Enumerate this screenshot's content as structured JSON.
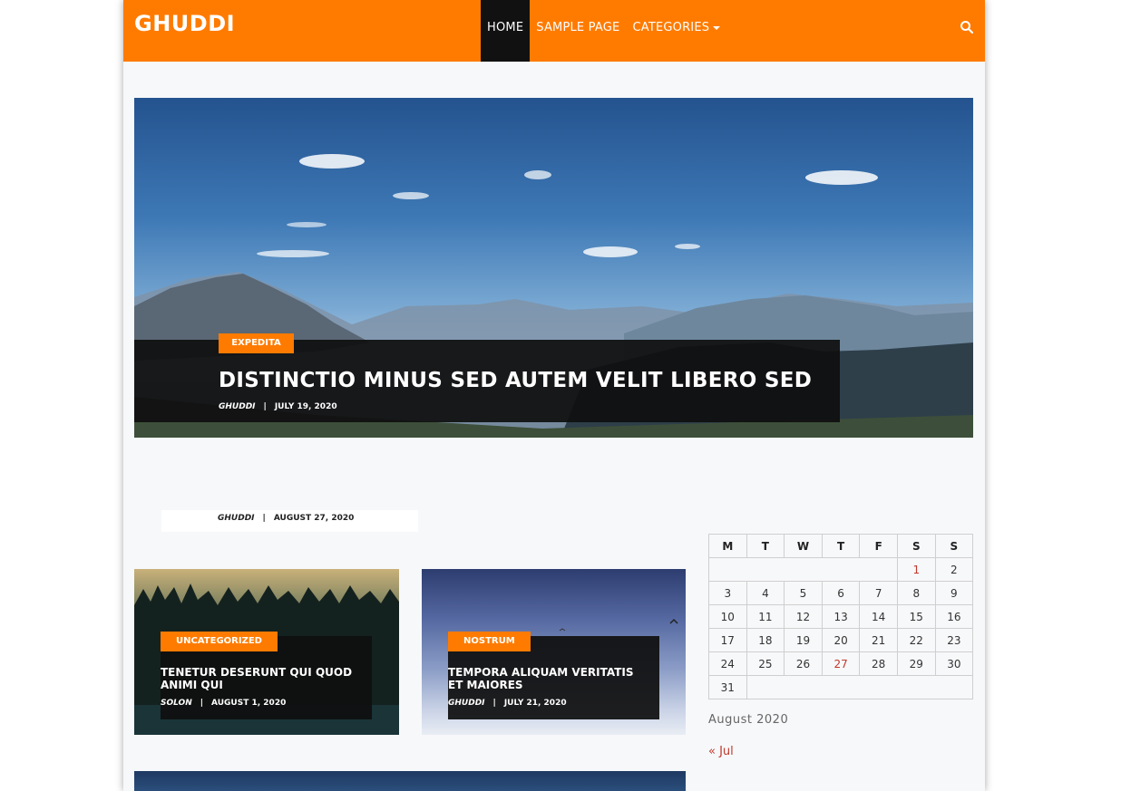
{
  "site": {
    "title": "GHUDDI"
  },
  "nav": {
    "items": [
      {
        "label": "HOME",
        "active": true
      },
      {
        "label": "SAMPLE PAGE",
        "active": false
      },
      {
        "label": "CATEGORIES",
        "active": false
      }
    ],
    "search_icon": "search-icon"
  },
  "hero": {
    "category": "EXPEDITA",
    "title": "DISTINCTIO MINUS SED AUTEM VELIT LIBERO SED",
    "author": "GHUDDI",
    "date": "JULY 19, 2020"
  },
  "post_meta": {
    "author": "GHUDDI",
    "date": "AUGUST 27, 2020"
  },
  "cards": [
    {
      "category": "UNCATEGORIZED",
      "title": "TENETUR DESERUNT QUI QUOD ANIMI QUI",
      "author": "SOLON",
      "date": "AUGUST 1, 2020"
    },
    {
      "category": "NOSTRUM",
      "title": "TEMPORA ALIQUAM VERITATIS ET MAIORES",
      "author": "GHUDDI",
      "date": "JULY 21, 2020"
    }
  ],
  "calendar": {
    "headers": [
      "M",
      "T",
      "W",
      "T",
      "F",
      "S",
      "S"
    ],
    "rows": [
      [
        "",
        "",
        "",
        "",
        "",
        "1",
        "2"
      ],
      [
        "3",
        "4",
        "5",
        "6",
        "7",
        "8",
        "9"
      ],
      [
        "10",
        "11",
        "12",
        "13",
        "14",
        "15",
        "16"
      ],
      [
        "17",
        "18",
        "19",
        "20",
        "21",
        "22",
        "23"
      ],
      [
        "24",
        "25",
        "26",
        "27",
        "28",
        "29",
        "30"
      ],
      [
        "31",
        "",
        "",
        "",
        "",
        "",
        ""
      ]
    ],
    "linked_days": [
      "1",
      "27"
    ],
    "caption": "August 2020",
    "prev": "« Jul"
  },
  "colors": {
    "accent": "#ff7b00",
    "link": "#c0392b",
    "overlay": "#0f0f0f"
  }
}
